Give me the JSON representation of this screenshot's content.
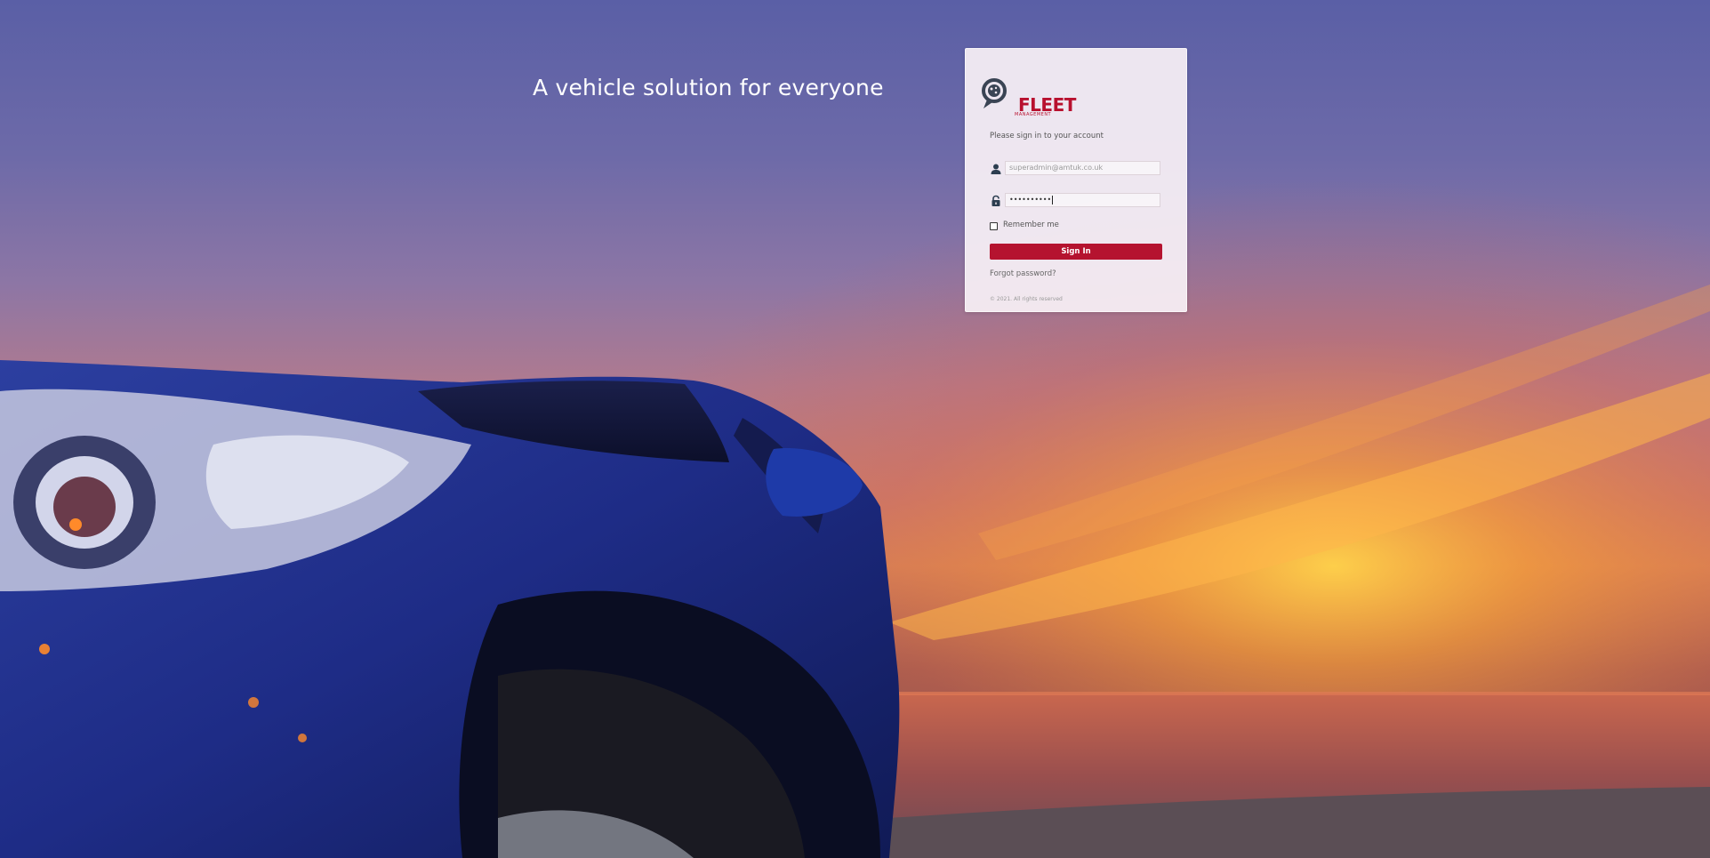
{
  "hero": {
    "tagline": "A vehicle solution for everyone"
  },
  "login": {
    "logo_text": "FLEET",
    "logo_subtext": "MANAGEMENT",
    "prompt": "Please sign in to your account",
    "email_value": "superadmin@amtuk.co.uk",
    "password_masked": "••••••••••",
    "remember_label": "Remember me",
    "remember_checked": false,
    "signin_label": "Sign In",
    "forgot_label": "Forgot password?",
    "copyright": "© 2021. All rights reserved"
  },
  "colors": {
    "brand_red": "#b5132f",
    "icon_dark": "#2c3e50"
  },
  "icons": {
    "email_field": "user-icon",
    "password_field": "lock-icon",
    "logo": "search-magnifier-logo-icon"
  }
}
